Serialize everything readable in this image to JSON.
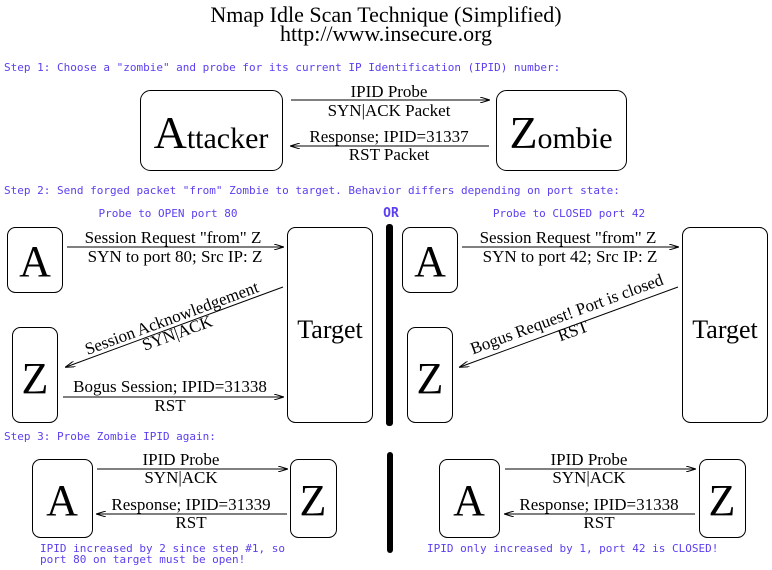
{
  "title": "Nmap Idle Scan Technique (Simplified)",
  "subtitle": "http://www.insecure.org",
  "colors": {
    "step_text": "#5b3ff0",
    "lines": "#000000",
    "background": "#ffffff"
  },
  "step1": {
    "heading": "Step 1: Choose a \"zombie\" and probe for its current IP Identification (IPID) number:",
    "attacker": {
      "big": "A",
      "rest": "ttacker"
    },
    "zombie": {
      "big": "Z",
      "rest": "ombie"
    },
    "probe_top": "IPID Probe",
    "probe_bottom": "SYN|ACK Packet",
    "response_top": "Response; IPID=31337",
    "response_bottom": "RST Packet"
  },
  "step2": {
    "heading": "Step 2: Send forged packet \"from\" Zombie to target. Behavior differs depending on port state:",
    "or_label": "OR",
    "open": {
      "label": "Probe to OPEN port 80",
      "attacker": "A",
      "zombie": "Z",
      "target": "Target",
      "request_top": "Session Request \"from\" Z",
      "request_bottom": "SYN to port 80; Src IP: Z",
      "reply_top": "Session Acknowledgement",
      "reply_bottom": "SYN|ACK",
      "zombie_reply_top": "Bogus Session; IPID=31338",
      "zombie_reply_bottom": "RST"
    },
    "closed": {
      "label": "Probe to CLOSED port 42",
      "attacker": "A",
      "zombie": "Z",
      "target": "Target",
      "request_top": "Session Request \"from\" Z",
      "request_bottom": "SYN to port 42; Src IP: Z",
      "reply_top": "Bogus Request! Port is closed",
      "reply_bottom": "RST"
    }
  },
  "step3": {
    "heading": "Step 3: Probe Zombie IPID again:",
    "open": {
      "attacker": "A",
      "zombie": "Z",
      "probe_top": "IPID Probe",
      "probe_bottom": "SYN|ACK",
      "response_top": "Response; IPID=31339",
      "response_bottom": "RST",
      "conclusion_line1": "IPID increased by 2 since step #1, so",
      "conclusion_line2": "port 80 on target must be open!"
    },
    "closed": {
      "attacker": "A",
      "zombie": "Z",
      "probe_top": "IPID Probe",
      "probe_bottom": "SYN|ACK",
      "response_top": "Response; IPID=31338",
      "response_bottom": "RST",
      "conclusion": "IPID only increased by 1, port 42 is CLOSED!"
    }
  }
}
